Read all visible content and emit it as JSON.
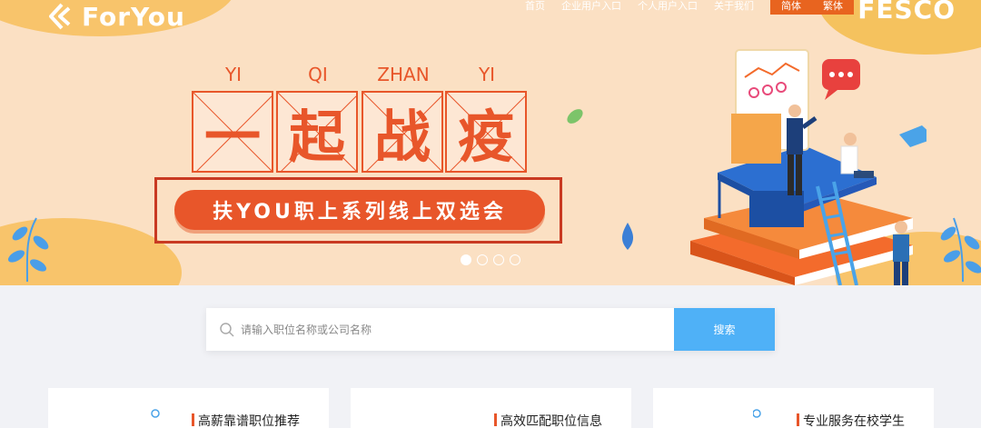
{
  "brand": {
    "logo_text": "ForYou",
    "partner": "FESCO"
  },
  "nav": {
    "items": [
      "首页",
      "企业用户入口",
      "个人用户入口",
      "关于我们"
    ],
    "lang": [
      "简体",
      "繁体"
    ]
  },
  "banner": {
    "chars": [
      {
        "pinyin": "YI",
        "char": "一"
      },
      {
        "pinyin": "QI",
        "char": "起"
      },
      {
        "pinyin": "ZHAN",
        "char": "战"
      },
      {
        "pinyin": "YI",
        "char": "疫"
      }
    ],
    "slogan": "扶YOU职上系列线上双选会",
    "slides": 4,
    "active_slide": 0
  },
  "search": {
    "placeholder": "请输入职位名称或公司名称",
    "value": "",
    "button": "搜索"
  },
  "cards": [
    {
      "title": "高薪靠谱职位推荐"
    },
    {
      "title": "高效匹配职位信息"
    },
    {
      "title": "专业服务在校学生"
    }
  ],
  "colors": {
    "accent": "#e8562a",
    "search_button": "#4fb1f7",
    "banner_bg": "#fbe0c3"
  }
}
